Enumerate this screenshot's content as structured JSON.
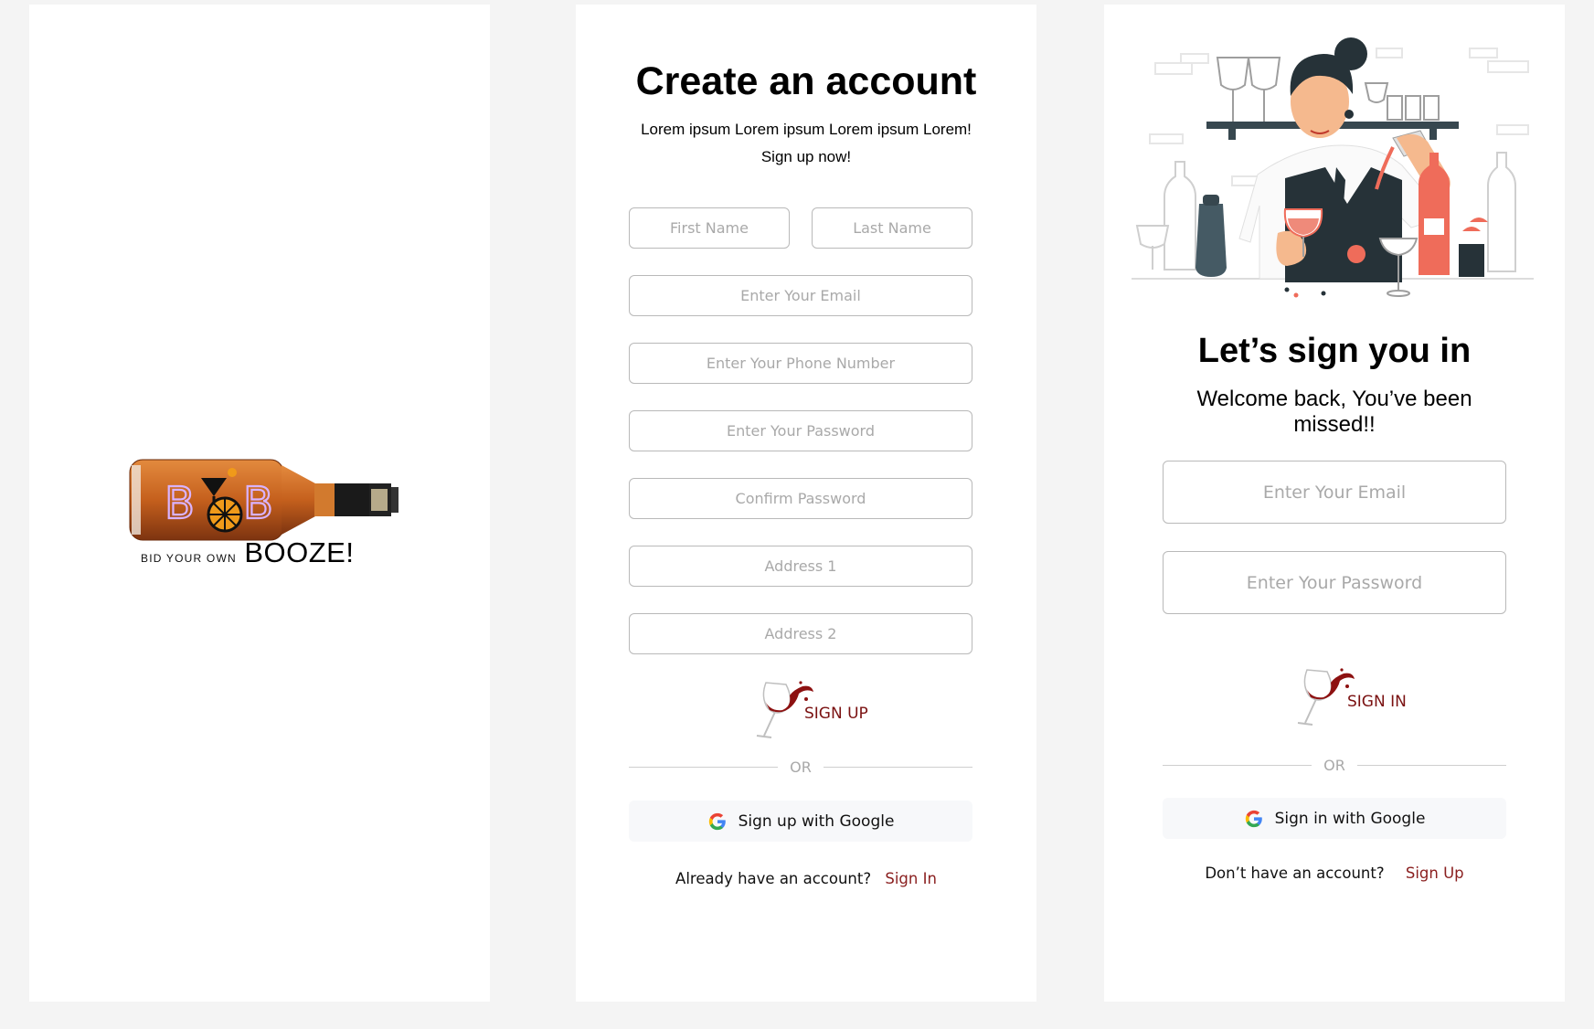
{
  "splash": {
    "logo_text": "BYOB",
    "tagline_small": "BID YOUR OWN",
    "tagline_big": "BOOZE!"
  },
  "signup": {
    "title": "Create an account",
    "subtitle_line1": "Lorem ipsum Lorem ipsum Lorem ipsum Lorem!",
    "subtitle_line2": "Sign up now!",
    "fields": {
      "first_name": "First Name",
      "last_name": "Last Name",
      "email": "Enter Your Email",
      "phone": "Enter Your Phone Number",
      "password": "Enter Your Password",
      "confirm_password": "Confirm Password",
      "address1": "Address 1",
      "address2": "Address 2"
    },
    "cta_label": "SIGN UP",
    "or_label": "OR",
    "google_label": "Sign up with Google",
    "footer_text": "Already have an account?",
    "footer_link": "Sign In"
  },
  "signin": {
    "title": "Let’s sign you in",
    "subtitle_line1": "Welcome back, You’ve been",
    "subtitle_line2": "missed!!",
    "fields": {
      "email": "Enter Your Email",
      "password": "Enter Your Password"
    },
    "cta_label": "SIGN IN",
    "or_label": "OR",
    "google_label": "Sign in with Google",
    "footer_text": "Don’t have an account?",
    "footer_link": "Sign Up"
  },
  "colors": {
    "background": "#f4f4f4",
    "panel": "#ffffff",
    "accent": "#7a1111",
    "placeholder": "#a9a9a9",
    "bottle_amber": "#c8621e"
  }
}
